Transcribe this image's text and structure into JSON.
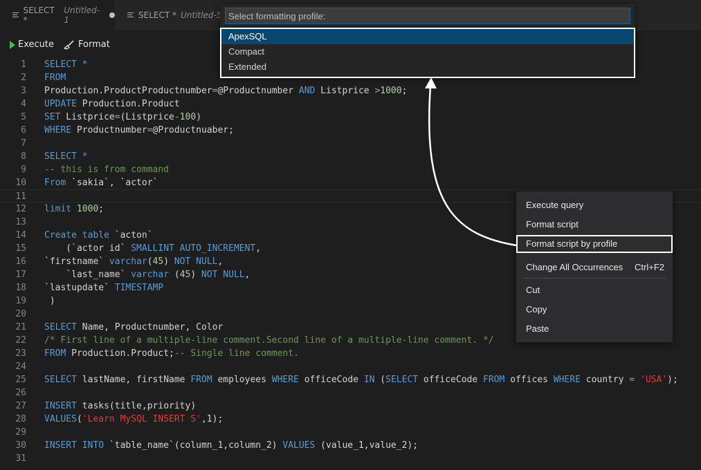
{
  "tabs": [
    {
      "name": "SELECT *",
      "sub": "Untitled-1",
      "dirty": true
    },
    {
      "name": "SELECT *",
      "sub": "Untitled-5"
    }
  ],
  "toolbar": {
    "execute_label": "Execute",
    "format_label": "Format"
  },
  "profile_picker": {
    "placeholder": "Select formatting profile:",
    "options": [
      "ApexSQL",
      "Compact",
      "Extended"
    ],
    "selected": "ApexSQL"
  },
  "context_menu": {
    "items": [
      {
        "label": "Execute query"
      },
      {
        "label": "Format script"
      },
      {
        "label": "Format script by profile",
        "highlighted": true
      },
      {
        "label": "Change All Occurrences",
        "shortcut": "Ctrl+F2"
      },
      {
        "label": "Cut"
      },
      {
        "label": "Copy"
      },
      {
        "label": "Paste"
      }
    ]
  },
  "editor": {
    "lines": [
      {
        "n": "1",
        "t": [
          [
            "kw",
            "SELECT *"
          ]
        ]
      },
      {
        "n": "2",
        "t": [
          [
            "kw",
            "FROM"
          ]
        ]
      },
      {
        "n": "3",
        "t": [
          [
            "p",
            "Production.ProductProductnumber"
          ],
          [
            "op",
            "="
          ],
          [
            "p",
            "@Productnumber "
          ],
          [
            "kw",
            "AND"
          ],
          [
            "p",
            " Listprice "
          ],
          [
            "op",
            ">"
          ],
          [
            "num",
            "1000"
          ],
          [
            "p",
            ";"
          ]
        ]
      },
      {
        "n": "4",
        "t": [
          [
            "kw",
            "UPDATE"
          ],
          [
            "p",
            " Production.Product"
          ]
        ]
      },
      {
        "n": "5",
        "t": [
          [
            "kw",
            "SET"
          ],
          [
            "p",
            " Listprice"
          ],
          [
            "op",
            "="
          ],
          [
            "p",
            "(Listprice"
          ],
          [
            "op",
            "-"
          ],
          [
            "num",
            "100"
          ],
          [
            "p",
            ")"
          ]
        ]
      },
      {
        "n": "6",
        "t": [
          [
            "kw",
            "WHERE"
          ],
          [
            "p",
            " Productnumber"
          ],
          [
            "op",
            "="
          ],
          [
            "p",
            "@Productnuaber;"
          ]
        ]
      },
      {
        "n": "7",
        "t": []
      },
      {
        "n": "8",
        "t": [
          [
            "kw",
            "SELECT *"
          ]
        ]
      },
      {
        "n": "9",
        "t": [
          [
            "cmt",
            "-- this is from command"
          ]
        ]
      },
      {
        "n": "10",
        "t": [
          [
            "kw",
            "From"
          ],
          [
            "p",
            " `sakia`, `actor`"
          ]
        ]
      },
      {
        "n": "11",
        "t": []
      },
      {
        "n": "12",
        "t": [
          [
            "kw",
            "limit"
          ],
          [
            "p",
            " "
          ],
          [
            "num",
            "1000"
          ],
          [
            "p",
            ";"
          ]
        ]
      },
      {
        "n": "13",
        "t": []
      },
      {
        "n": "14",
        "t": [
          [
            "kw",
            "Create table"
          ],
          [
            "p",
            " `acton`"
          ]
        ]
      },
      {
        "n": "15",
        "t": [
          [
            "p",
            "    (`actor id` "
          ],
          [
            "kw",
            "SMALLINT AUTO_INCREMENT"
          ],
          [
            "p",
            ","
          ]
        ]
      },
      {
        "n": "16",
        "t": [
          [
            "p",
            "`firstname` "
          ],
          [
            "kw",
            "varchar"
          ],
          [
            "p",
            "("
          ],
          [
            "num",
            "45"
          ],
          [
            "p",
            ") "
          ],
          [
            "kw",
            "NOT NULL"
          ],
          [
            "p",
            ","
          ]
        ]
      },
      {
        "n": "17",
        "t": [
          [
            "p",
            "    `last_name` "
          ],
          [
            "kw",
            "varchar"
          ],
          [
            "p",
            " ("
          ],
          [
            "num",
            "45"
          ],
          [
            "p",
            ") "
          ],
          [
            "kw",
            "NOT NULL"
          ],
          [
            "p",
            ","
          ]
        ]
      },
      {
        "n": "18",
        "t": [
          [
            "p",
            "`lastupdate` "
          ],
          [
            "kw",
            "TIMESTAMP"
          ]
        ]
      },
      {
        "n": "19",
        "t": [
          [
            "p",
            " )"
          ]
        ]
      },
      {
        "n": "20",
        "t": []
      },
      {
        "n": "21",
        "t": [
          [
            "kw",
            "SELECT"
          ],
          [
            "p",
            " Name, Productnumber, Color"
          ]
        ]
      },
      {
        "n": "22",
        "t": [
          [
            "cmt",
            "/* First line of a multiple-line comment.Second line of a multiple-line comment. */"
          ]
        ]
      },
      {
        "n": "23",
        "t": [
          [
            "kw",
            "FROM"
          ],
          [
            "p",
            " Production.Product;"
          ],
          [
            "cmt",
            "-- Single line comment."
          ]
        ]
      },
      {
        "n": "24",
        "t": []
      },
      {
        "n": "25",
        "t": [
          [
            "kw",
            "SELECT"
          ],
          [
            "p",
            " lastName, firstName "
          ],
          [
            "kw",
            "FROM"
          ],
          [
            "p",
            " employees "
          ],
          [
            "kw",
            "WHERE"
          ],
          [
            "p",
            " officeCode "
          ],
          [
            "kw",
            "IN"
          ],
          [
            "p",
            " ("
          ],
          [
            "kw",
            "SELECT"
          ],
          [
            "p",
            " officeCode "
          ],
          [
            "kw",
            "FROM"
          ],
          [
            "p",
            " offices "
          ],
          [
            "kw",
            "WHERE"
          ],
          [
            "p",
            " country "
          ],
          [
            "op",
            "="
          ],
          [
            "p",
            " "
          ],
          [
            "str",
            "'USA'"
          ],
          [
            "p",
            ");"
          ]
        ]
      },
      {
        "n": "26",
        "t": []
      },
      {
        "n": "27",
        "t": [
          [
            "kw",
            "INSERT"
          ],
          [
            "p",
            " tasks(title,priority)"
          ]
        ]
      },
      {
        "n": "28",
        "t": [
          [
            "kw",
            "VALUES"
          ],
          [
            "p",
            "("
          ],
          [
            "str",
            "'Learn MySQL INSERT S'"
          ],
          [
            "p",
            ",1);"
          ]
        ]
      },
      {
        "n": "29",
        "t": []
      },
      {
        "n": "30",
        "t": [
          [
            "kw",
            "INSERT INTO"
          ],
          [
            "p",
            " `table_name`(column_1,column_2) "
          ],
          [
            "kw",
            "VALUES"
          ],
          [
            "p",
            " (value_1,value_2);"
          ]
        ]
      },
      {
        "n": "31",
        "t": []
      }
    ]
  }
}
